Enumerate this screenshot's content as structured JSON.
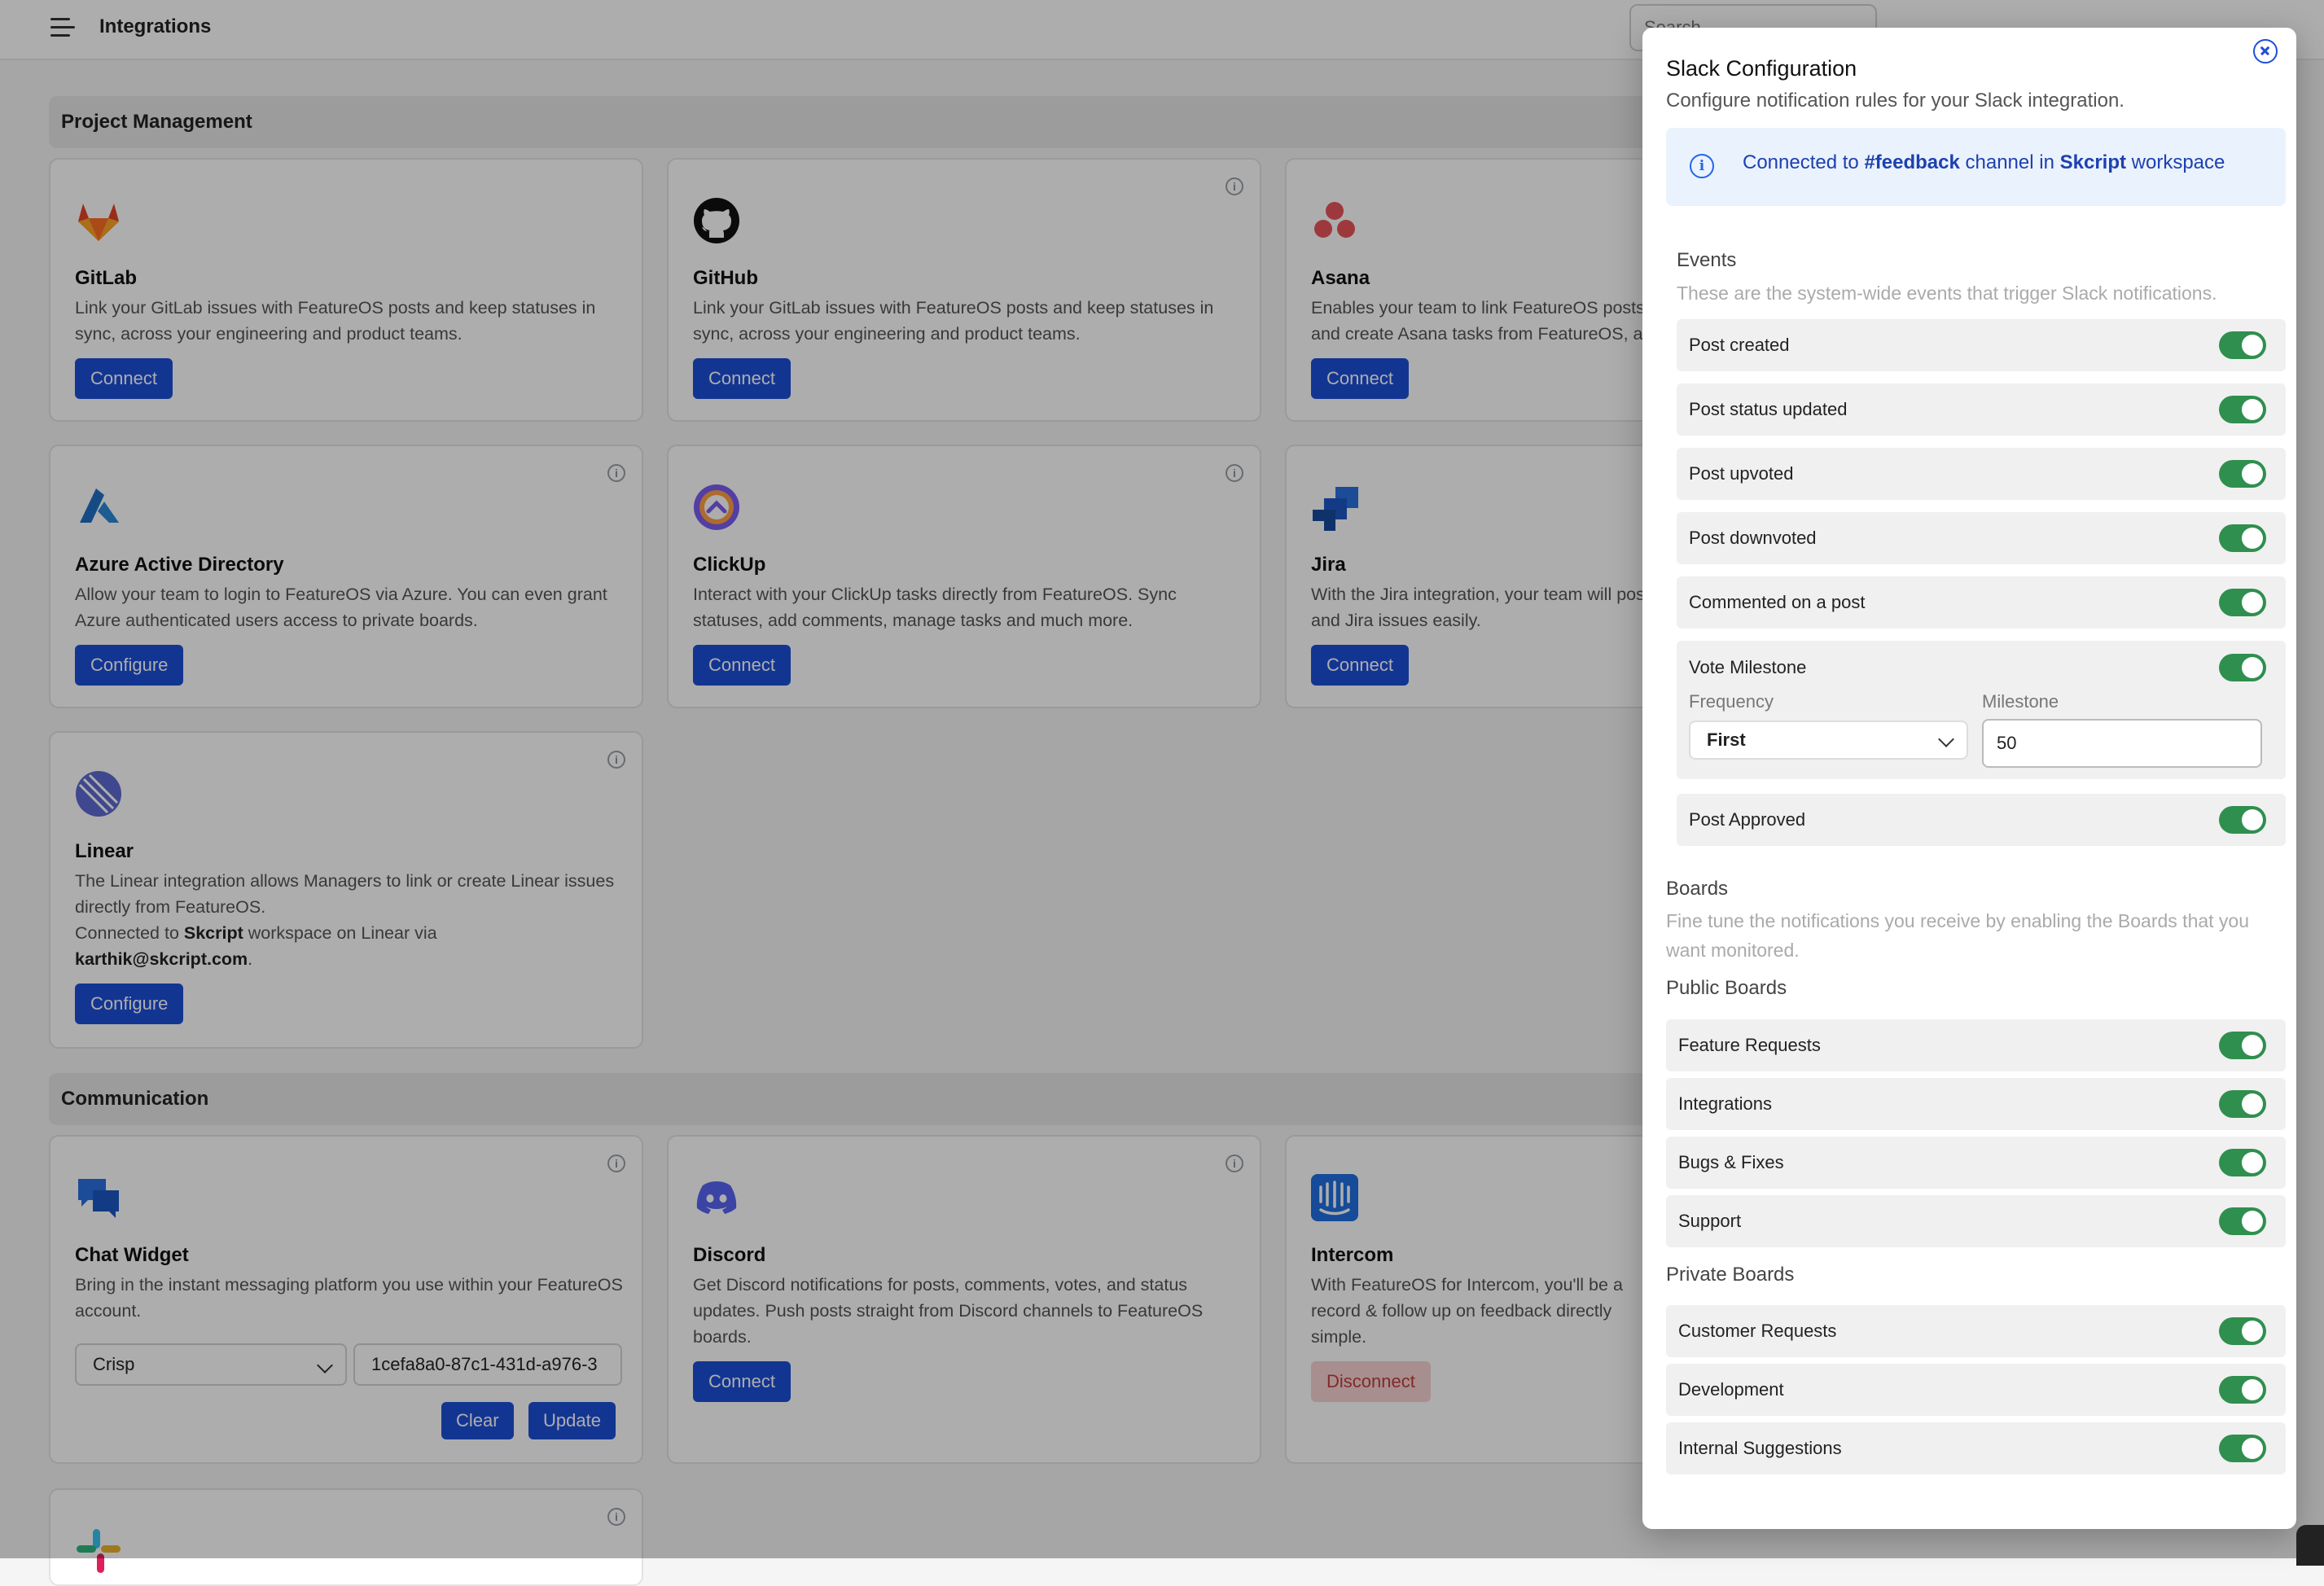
{
  "header": {
    "title": "Integrations",
    "search_placeholder": "Search"
  },
  "sections": {
    "project_management": "Project Management",
    "communication": "Communication"
  },
  "cards": {
    "gitlab": {
      "name": "GitLab",
      "desc": "Link your GitLab issues with FeatureOS posts and keep statuses in sync, across your engineering and product teams.",
      "button": "Connect"
    },
    "github": {
      "name": "GitHub",
      "desc": "Link your GitLab issues with FeatureOS posts and keep statuses in sync, across your engineering and product teams.",
      "button": "Connect"
    },
    "asana": {
      "name": "Asana",
      "desc": "Enables your team to link FeatureOS posts and create Asana tasks from FeatureOS, and",
      "button": "Connect"
    },
    "azure": {
      "name": "Azure Active Directory",
      "desc": "Allow your team to login to FeatureOS via Azure. You can even grant Azure authenticated users access to private boards.",
      "button": "Configure"
    },
    "clickup": {
      "name": "ClickUp",
      "desc": "Interact with your ClickUp tasks directly from FeatureOS. Sync statuses, add comments, manage tasks and much more.",
      "button": "Connect"
    },
    "jira": {
      "name": "Jira",
      "desc": "With the Jira integration, your team will posts and Jira issues easily.",
      "button": "Connect"
    },
    "linear": {
      "name": "Linear",
      "desc": "The Linear integration allows Managers to link or create Linear issues directly from FeatureOS.",
      "connected_prefix": "Connected to ",
      "workspace": "Skcript",
      "connected_mid": " workspace on Linear via",
      "email": "karthik@skcript.com",
      "period": ".",
      "button": "Configure"
    },
    "chat_widget": {
      "name": "Chat Widget",
      "desc": "Bring in the instant messaging platform you use within your FeatureOS account.",
      "provider": "Crisp",
      "key_value": "1cefa8a0-87c1-431d-a976-3",
      "clear": "Clear",
      "update": "Update"
    },
    "discord": {
      "name": "Discord",
      "desc": "Get Discord notifications for posts, comments, votes, and status updates. Push posts straight from Discord channels to FeatureOS boards.",
      "button": "Connect"
    },
    "intercom": {
      "name": "Intercom",
      "desc": "With FeatureOS for Intercom, you'll be a record & follow up on feedback directly simple.",
      "button": "Disconnect"
    }
  },
  "modal": {
    "title": "Slack Configuration",
    "subtitle": "Configure notification rules for your Slack integration.",
    "banner": {
      "prefix": "Connected to ",
      "channel": "#feedback",
      "mid": " channel in ",
      "workspace": "Skcript",
      "suffix": " workspace"
    },
    "events_title": "Events",
    "events_subtitle": "These are the system-wide events that trigger Slack notifications.",
    "events": [
      {
        "label": "Post created",
        "enabled": true
      },
      {
        "label": "Post status updated",
        "enabled": true
      },
      {
        "label": "Post upvoted",
        "enabled": true
      },
      {
        "label": "Post downvoted",
        "enabled": true
      },
      {
        "label": "Commented on a post",
        "enabled": true
      },
      {
        "label": "Vote Milestone",
        "enabled": true
      },
      {
        "label": "Post Approved",
        "enabled": true
      }
    ],
    "milestone": {
      "frequency_label": "Frequency",
      "frequency_value": "First",
      "milestone_label": "Milestone",
      "milestone_value": "50"
    },
    "boards_title": "Boards",
    "boards_subtitle": "Fine tune the notifications you receive by enabling the Boards that you want monitored.",
    "public_boards_title": "Public Boards",
    "public_boards": [
      {
        "label": "Feature Requests",
        "enabled": true
      },
      {
        "label": "Integrations",
        "enabled": true
      },
      {
        "label": "Bugs & Fixes",
        "enabled": true
      },
      {
        "label": "Support",
        "enabled": true
      }
    ],
    "private_boards_title": "Private Boards",
    "private_boards": [
      {
        "label": "Customer Requests",
        "enabled": true
      },
      {
        "label": "Development",
        "enabled": true
      },
      {
        "label": "Internal Suggestions",
        "enabled": true
      }
    ]
  },
  "colors": {
    "primary": "#1d4ed8",
    "toggle_on": "#2f8f4e",
    "danger_bg": "#f6d3d3",
    "danger_text": "#c43b3b"
  }
}
